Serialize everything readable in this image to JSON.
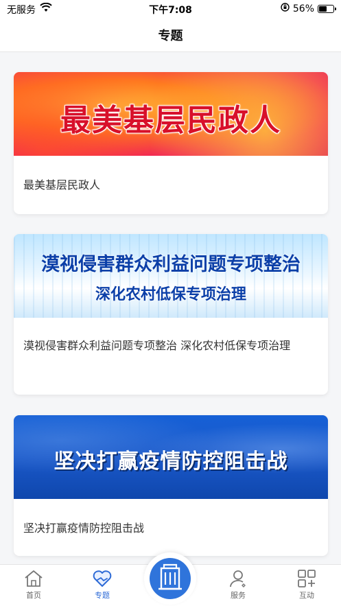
{
  "status_bar": {
    "carrier": "无服务",
    "time": "下午7:08",
    "battery": "56%",
    "battery_level": 0.56
  },
  "nav": {
    "title": "专题"
  },
  "cards": [
    {
      "banner_text": "最美基层民政人",
      "caption": "最美基层民政人"
    },
    {
      "banner_line1": "漠视侵害群众利益问题专项整治",
      "banner_line2": "深化农村低保专项治理",
      "caption": "漠视侵害群众利益问题专项整治 深化农村低保专项治理"
    },
    {
      "banner_text": "坚决打赢疫情防控阻击战",
      "caption": "坚决打赢疫情防控阻击战"
    }
  ],
  "tabs": [
    {
      "label": "首页",
      "icon": "home-icon",
      "active": false
    },
    {
      "label": "专题",
      "icon": "heart-hands-icon",
      "active": true
    },
    {
      "label": "",
      "icon": "building-icon",
      "active": false
    },
    {
      "label": "服务",
      "icon": "person-icon",
      "active": false
    },
    {
      "label": "互动",
      "icon": "grid-icon",
      "active": false
    }
  ],
  "colors": {
    "accent": "#2d6ad6",
    "center_button": "#2f74db",
    "background": "#f5f6f8"
  }
}
